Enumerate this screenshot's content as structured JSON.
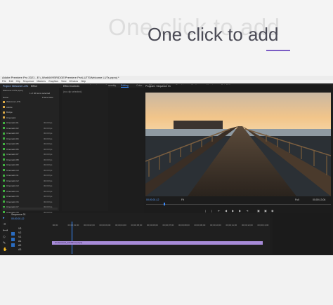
{
  "hero": {
    "ghost_text": "One click to add",
    "headline": "One click to add",
    "accent_color": "#7b5cc4"
  },
  "app": {
    "window_title": "Adobe Premiere Pro 2021 - E:\\_Work\\MYBRIDGE\\Premiere Pro\\LUTS\\Welcome LUTs.prproj *",
    "menu": [
      "File",
      "Edit",
      "Clip",
      "Sequence",
      "Markers",
      "Graphics",
      "View",
      "Window",
      "Help"
    ],
    "workspaces": [
      "Learning",
      "Assembly",
      "Editing",
      "Color",
      "Effects",
      "Audio",
      "Graphics",
      "Captions",
      "Libraries",
      "Ext. Editor"
    ],
    "active_workspace": "Editing",
    "project_panel": {
      "tabs": [
        "Project: Welcome LUTs",
        "Effect"
      ],
      "file_name": "Welcome LUTs.prproj",
      "item_count": "1 of 40 items selected",
      "columns": [
        "Name",
        "Frame Rate"
      ],
      "items": [
        {
          "name": "Welcome LUTs",
          "type": "folder",
          "rate": ""
        },
        {
          "name": "Adobe",
          "type": "folder",
          "rate": ""
        },
        {
          "name": "Bridge",
          "type": "folder",
          "rate": ""
        },
        {
          "name": "Cinematic",
          "type": "folder",
          "rate": ""
        },
        {
          "name": "Cinematic 01",
          "type": "clip",
          "rate": "30.00 fps"
        },
        {
          "name": "Cinematic 02",
          "type": "clip",
          "rate": "30.00 fps"
        },
        {
          "name": "Cinematic 03",
          "type": "clip",
          "rate": "30.00 fps"
        },
        {
          "name": "Cinematic 04",
          "type": "clip",
          "rate": "30.00 fps"
        },
        {
          "name": "Cinematic 05",
          "type": "clip",
          "rate": "30.00 fps"
        },
        {
          "name": "Cinematic 06",
          "type": "clip",
          "rate": "30.00 fps"
        },
        {
          "name": "Cinematic 07",
          "type": "clip",
          "rate": "30.00 fps"
        },
        {
          "name": "Cinematic 08",
          "type": "clip",
          "rate": "30.00 fps"
        },
        {
          "name": "Cinematic 09",
          "type": "clip",
          "rate": "30.00 fps"
        },
        {
          "name": "Cinematic 10",
          "type": "clip",
          "rate": "30.00 fps"
        },
        {
          "name": "Cinematic 11",
          "type": "clip",
          "rate": "30.00 fps"
        },
        {
          "name": "Cinematic 12",
          "type": "clip",
          "rate": "30.00 fps"
        },
        {
          "name": "Cinematic 13",
          "type": "clip",
          "rate": "30.00 fps"
        },
        {
          "name": "Cinematic 14",
          "type": "clip",
          "rate": "30.00 fps"
        },
        {
          "name": "Cinematic 15",
          "type": "clip",
          "rate": "30.00 fps"
        },
        {
          "name": "Cinematic 16",
          "type": "clip",
          "rate": "30.00 fps"
        },
        {
          "name": "Cinematic 17",
          "type": "clip",
          "rate": "30.00 fps"
        },
        {
          "name": "Cinematic 18",
          "type": "clip",
          "rate": "30.00 fps"
        }
      ]
    },
    "effect_controls": {
      "tab": "Effect Controls",
      "no_clip": "(no clip selected)"
    },
    "program_monitor": {
      "tab": "Program: Sequence 01",
      "timecode": "00;00;01;12",
      "fit": "Fit",
      "duration": "00;00;13;04",
      "quality": "Full"
    },
    "timeline": {
      "tab": "Sequence 01",
      "timecode": "00;00;01;12",
      "ruler": [
        ":00;00",
        "00;00;01;00",
        "00;00;02;00",
        "00;00;03;00",
        "00;00;04;00",
        "00;00;05;00",
        "00;00;06;00",
        "00;00;07;00",
        "00;00;08;00",
        "00;00;09;00",
        "00;00;10;00",
        "00;00;11;00",
        "00;00;12;00",
        "00;00;13;00"
      ],
      "tracks": [
        "V3",
        "V2",
        "V1",
        "A1",
        "A2",
        "A3"
      ],
      "clip_label": "shutterstock_101934.mp4 [V]"
    }
  }
}
